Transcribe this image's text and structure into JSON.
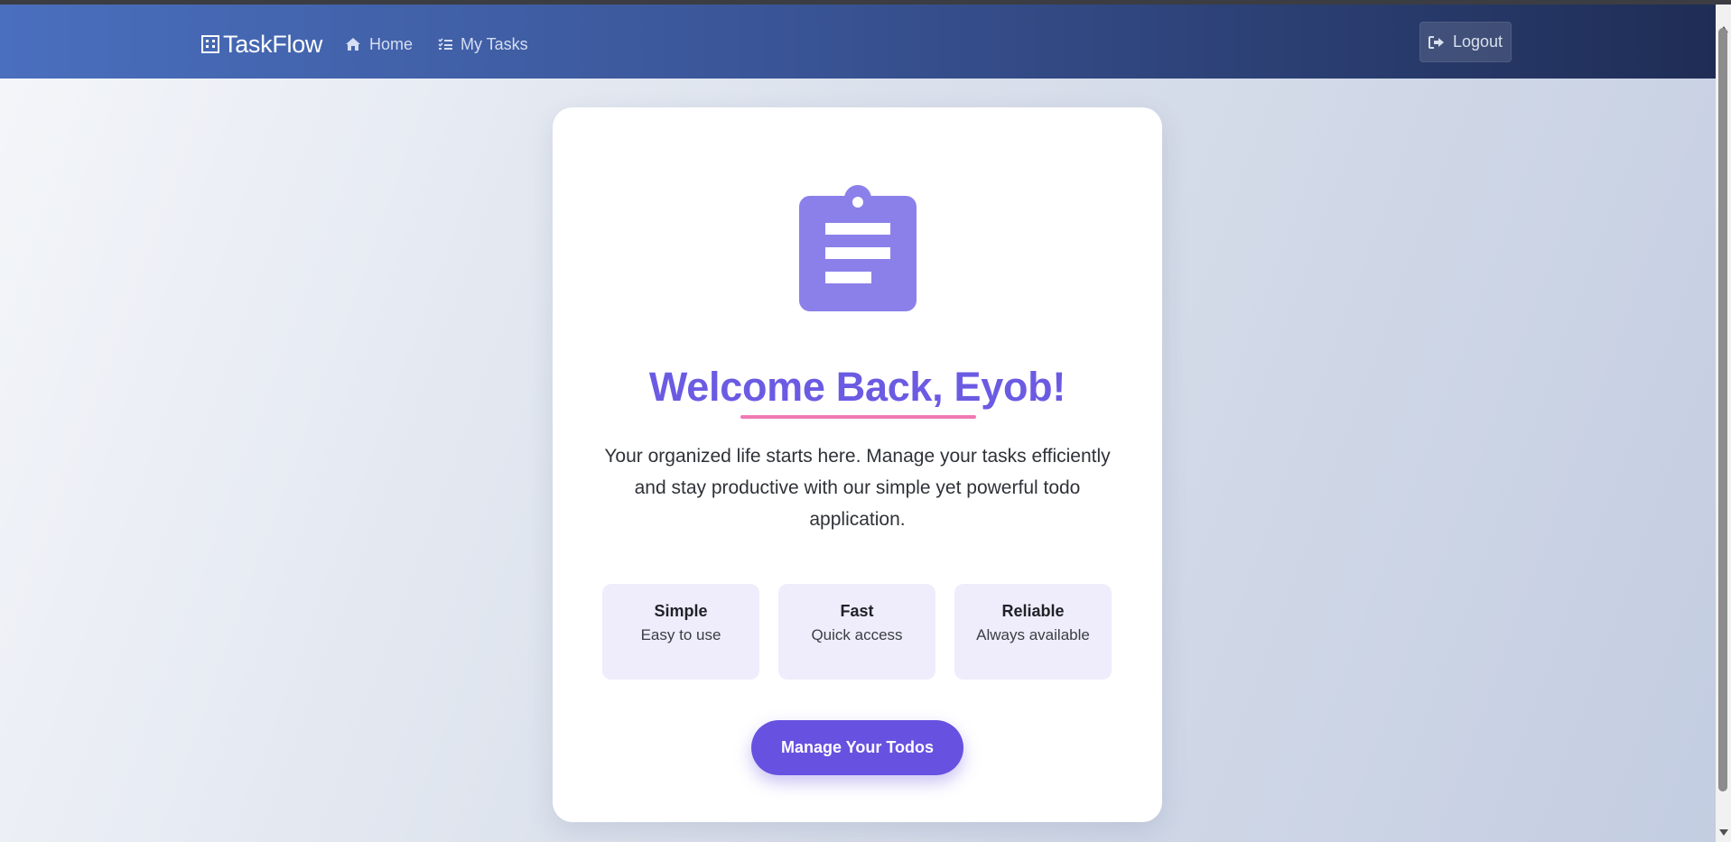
{
  "navbar": {
    "brand": "TaskFlow",
    "brand_icon": "building-icon",
    "links": [
      {
        "label": "Home",
        "icon": "home-icon"
      },
      {
        "label": "My Tasks",
        "icon": "tasks-list-icon"
      }
    ],
    "logout": {
      "label": "Logout",
      "icon": "sign-out-icon"
    }
  },
  "hero": {
    "icon": "clipboard-icon",
    "title": "Welcome Back, Eyob!",
    "description": "Your organized life starts here. Manage your tasks efficiently and stay productive with our simple yet powerful todo application.",
    "features": [
      {
        "title": "Simple",
        "subtitle": "Easy to use"
      },
      {
        "title": "Fast",
        "subtitle": "Quick access"
      },
      {
        "title": "Reliable",
        "subtitle": "Always available"
      }
    ],
    "cta_label": "Manage Your Todos"
  },
  "colors": {
    "navbar_start": "#4a6fbe",
    "navbar_end": "#1f2d55",
    "accent": "#6751e0",
    "title": "#6b5be3",
    "underline": "#f079b3",
    "feature_bg": "#efedfb"
  }
}
